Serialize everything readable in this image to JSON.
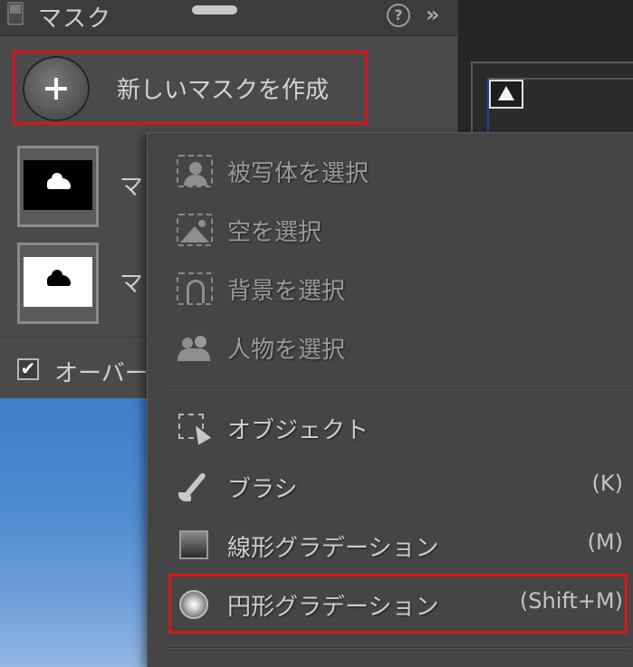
{
  "panel": {
    "title": "マスク",
    "help_glyph": "?",
    "expand_glyph": "»",
    "new_mask_label": "新しいマスクを作成",
    "masks": [
      {
        "label": "マ",
        "thumb": "dark"
      },
      {
        "label": "マ",
        "thumb": "light"
      }
    ],
    "overlay_check": "✔",
    "overlay_label": "オーバー"
  },
  "menu": {
    "items": [
      {
        "label": "被写体を選択",
        "enabled": false,
        "icon": "subject-select-icon"
      },
      {
        "label": "空を選択",
        "enabled": false,
        "icon": "sky-select-icon"
      },
      {
        "label": "背景を選択",
        "enabled": false,
        "icon": "background-select-icon"
      },
      {
        "label": "人物を選択",
        "enabled": false,
        "icon": "people-select-icon"
      },
      {
        "label": "オブジェクト",
        "enabled": true,
        "icon": "object-select-icon"
      },
      {
        "label": "ブラシ",
        "shortcut": "(K)",
        "enabled": true,
        "icon": "brush-icon"
      },
      {
        "label": "線形グラデーション",
        "shortcut": "(M)",
        "enabled": true,
        "icon": "linear-gradient-icon"
      },
      {
        "label": "円形グラデーション",
        "shortcut": "(Shift+M)",
        "enabled": true,
        "icon": "radial-gradient-icon"
      }
    ]
  },
  "colors": {
    "highlight": "#d8161a",
    "panel_bg": "#4a4a4a",
    "menu_bg": "#454545"
  }
}
